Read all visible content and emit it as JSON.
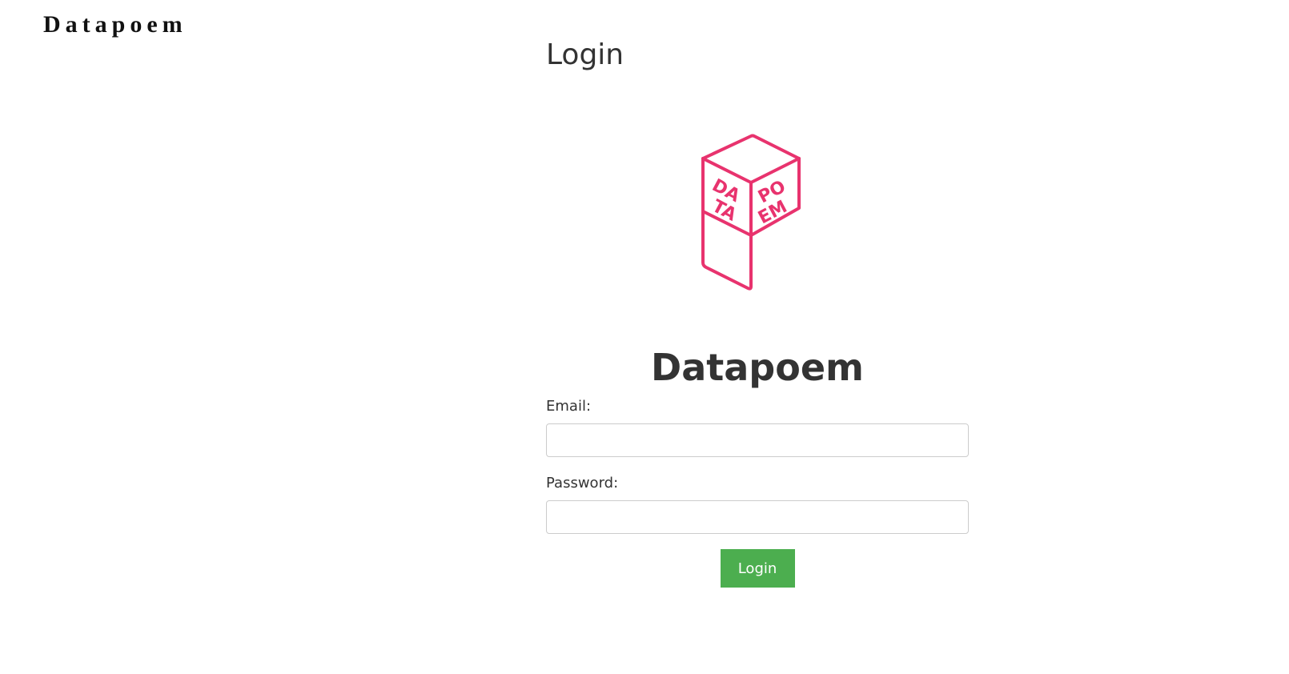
{
  "header": {
    "brand": "Datapoem"
  },
  "page": {
    "title": "Login"
  },
  "logo": {
    "icon": "datapoem-cube-logo",
    "color": "#e8336e",
    "left_text": [
      "DA",
      "TA"
    ],
    "right_text": [
      "PO",
      "EM"
    ]
  },
  "app": {
    "name": "Datapoem"
  },
  "form": {
    "email_label": "Email:",
    "email_value": "",
    "password_label": "Password:",
    "password_value": "",
    "submit_label": "Login",
    "submit_color": "#4cae4f"
  }
}
